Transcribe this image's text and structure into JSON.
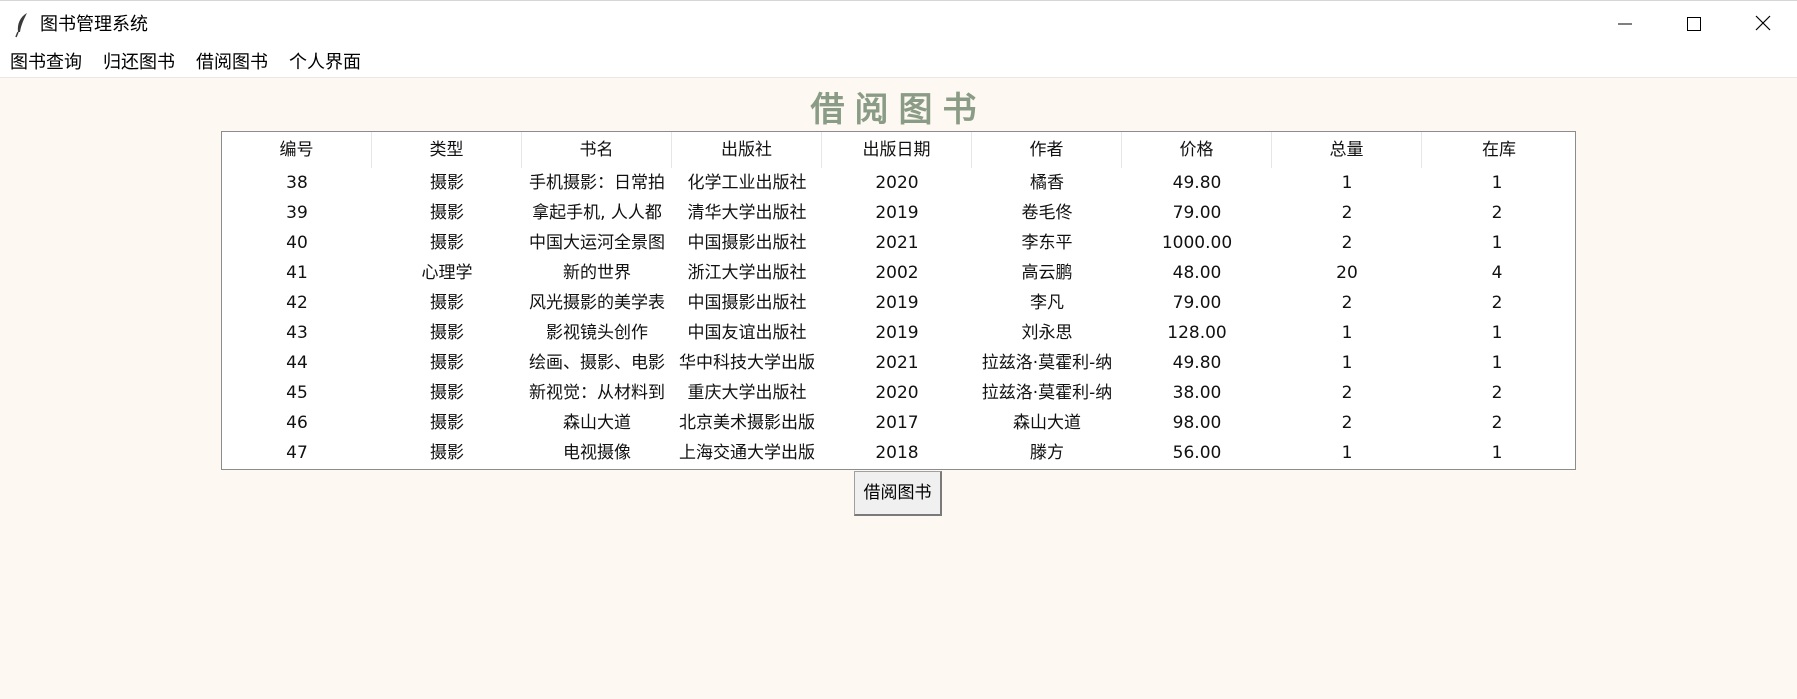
{
  "window": {
    "title": "图书管理系统",
    "icon": "feather-icon"
  },
  "menu": [
    {
      "label": "图书查询"
    },
    {
      "label": "归还图书"
    },
    {
      "label": "借阅图书"
    },
    {
      "label": "个人界面"
    }
  ],
  "page": {
    "title": "借阅图书",
    "title_color": "#8a9c86",
    "background": "#fdf8f1"
  },
  "table": {
    "columns": [
      "编号",
      "类型",
      "书名",
      "出版社",
      "出版日期",
      "作者",
      "价格",
      "总量",
      "在库"
    ],
    "rows": [
      [
        "38",
        "摄影",
        "手机摄影：日常拍",
        "化学工业出版社",
        "2020",
        "橘香",
        "49.80",
        "1",
        "1"
      ],
      [
        "39",
        "摄影",
        "拿起手机, 人人都",
        "清华大学出版社",
        "2019",
        "卷毛佟",
        "79.00",
        "2",
        "2"
      ],
      [
        "40",
        "摄影",
        "中国大运河全景图",
        "中国摄影出版社",
        "2021",
        "李东平",
        "1000.00",
        "2",
        "1"
      ],
      [
        "41",
        "心理学",
        "新的世界",
        "浙江大学出版社",
        "2002",
        "高云鹏",
        "48.00",
        "20",
        "4"
      ],
      [
        "42",
        "摄影",
        "风光摄影的美学表",
        "中国摄影出版社",
        "2019",
        "李凡",
        "79.00",
        "2",
        "2"
      ],
      [
        "43",
        "摄影",
        "影视镜头创作",
        "中国友谊出版社",
        "2019",
        "刘永思",
        "128.00",
        "1",
        "1"
      ],
      [
        "44",
        "摄影",
        "绘画、摄影、电影",
        "华中科技大学出版",
        "2021",
        "拉兹洛·莫霍利-纳",
        "49.80",
        "1",
        "1"
      ],
      [
        "45",
        "摄影",
        "新视觉：从材料到",
        "重庆大学出版社",
        "2020",
        "拉兹洛·莫霍利-纳",
        "38.00",
        "2",
        "2"
      ],
      [
        "46",
        "摄影",
        "森山大道",
        "北京美术摄影出版",
        "2017",
        "森山大道",
        "98.00",
        "2",
        "2"
      ],
      [
        "47",
        "摄影",
        "电视摄像",
        "上海交通大学出版",
        "2018",
        "滕方",
        "56.00",
        "1",
        "1"
      ]
    ]
  },
  "actions": {
    "borrow_label": "借阅图书"
  }
}
